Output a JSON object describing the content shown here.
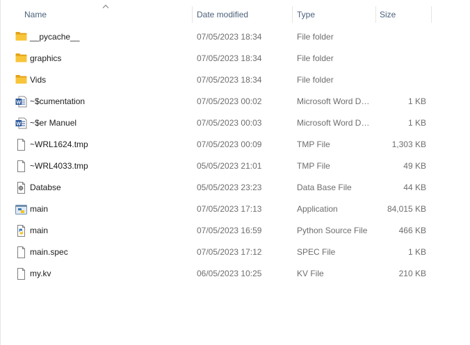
{
  "columns": {
    "name": "Name",
    "date": "Date modified",
    "type": "Type",
    "size": "Size"
  },
  "sort": {
    "column": "name",
    "direction": "ascending",
    "icon": "sort-up-arrow-icon"
  },
  "files": [
    {
      "name": "__pycache__",
      "date": "07/05/2023 18:34",
      "type": "File folder",
      "size": "",
      "icon": "folder-icon"
    },
    {
      "name": "graphics",
      "date": "07/05/2023 18:34",
      "type": "File folder",
      "size": "",
      "icon": "folder-icon"
    },
    {
      "name": "Vids",
      "date": "07/05/2023 18:34",
      "type": "File folder",
      "size": "",
      "icon": "folder-icon"
    },
    {
      "name": "~$cumentation",
      "date": "07/05/2023 00:02",
      "type": "Microsoft Word Document",
      "size": "1 KB",
      "icon": "word-document-icon"
    },
    {
      "name": "~$er Manuel",
      "date": "07/05/2023 00:03",
      "type": "Microsoft Word Document",
      "size": "1 KB",
      "icon": "word-document-icon"
    },
    {
      "name": "~WRL1624.tmp",
      "date": "07/05/2023 00:09",
      "type": "TMP File",
      "size": "1,303 KB",
      "icon": "blank-file-icon"
    },
    {
      "name": "~WRL4033.tmp",
      "date": "05/05/2023 21:01",
      "type": "TMP File",
      "size": "49 KB",
      "icon": "blank-file-icon"
    },
    {
      "name": "Databse",
      "date": "05/05/2023 23:23",
      "type": "Data Base File",
      "size": "44 KB",
      "icon": "database-file-icon"
    },
    {
      "name": "main",
      "date": "07/05/2023 17:13",
      "type": "Application",
      "size": "84,015 KB",
      "icon": "application-icon"
    },
    {
      "name": "main",
      "date": "07/05/2023 16:59",
      "type": "Python Source File",
      "size": "466 KB",
      "icon": "python-file-icon"
    },
    {
      "name": "main.spec",
      "date": "07/05/2023 17:12",
      "type": "SPEC File",
      "size": "1 KB",
      "icon": "blank-file-icon"
    },
    {
      "name": "my.kv",
      "date": "06/05/2023 10:25",
      "type": "KV File",
      "size": "210 KB",
      "icon": "blank-file-icon"
    }
  ],
  "colors": {
    "header_text": "#4c607a",
    "folder": "#f8c53a",
    "word_blue": "#2b579a",
    "secondary_text": "#6d6d6d"
  }
}
